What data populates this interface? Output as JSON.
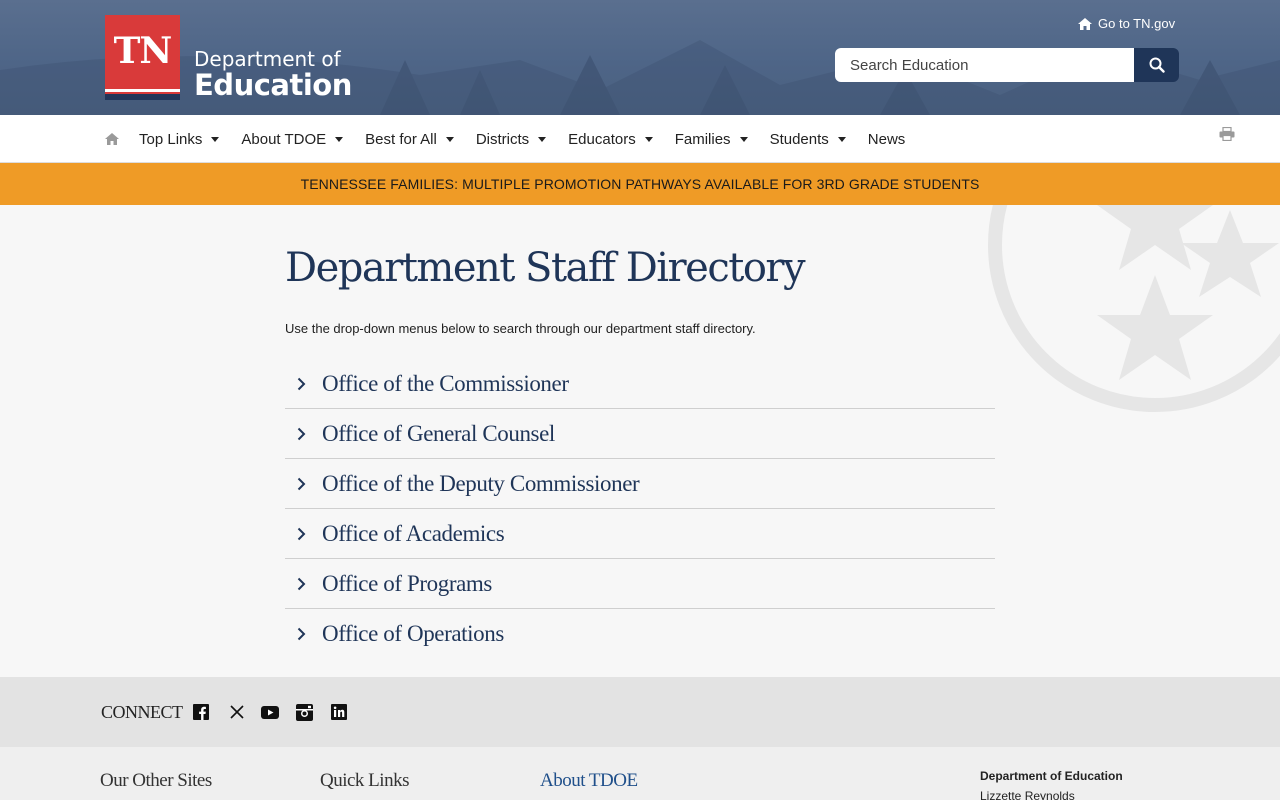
{
  "header": {
    "logo_mark": "TN",
    "logo_line1": "Department of",
    "logo_line2": "Education",
    "goto_link": "Go to TN.gov",
    "search_placeholder": "Search Education"
  },
  "nav": {
    "items": [
      {
        "label": "Top Links",
        "dropdown": true
      },
      {
        "label": "About TDOE",
        "dropdown": true
      },
      {
        "label": "Best for All",
        "dropdown": true
      },
      {
        "label": "Districts",
        "dropdown": true
      },
      {
        "label": "Educators",
        "dropdown": true
      },
      {
        "label": "Families",
        "dropdown": true
      },
      {
        "label": "Students",
        "dropdown": true
      },
      {
        "label": "News",
        "dropdown": false
      }
    ]
  },
  "alert": {
    "text": "TENNESSEE FAMILIES: MULTIPLE PROMOTION PATHWAYS AVAILABLE FOR 3RD GRADE STUDENTS",
    "color": "#ef9b26"
  },
  "main": {
    "title": "Department Staff Directory",
    "intro": "Use the drop-down menus below to search through our department staff directory.",
    "offices": [
      "Office of the Commissioner",
      "Office of General Counsel",
      "Office of the Deputy Commissioner",
      "Office of Academics",
      "Office of Programs",
      "Office of Operations"
    ]
  },
  "connect": {
    "label": "CONNECT",
    "icons": [
      "facebook-icon",
      "x-icon",
      "youtube-icon",
      "instagram-icon",
      "linkedin-icon"
    ]
  },
  "footer": {
    "col1": "Our Other Sites",
    "col2": "Quick Links",
    "col3": "About TDOE",
    "dept": "Department of Education",
    "name": "Lizzette Reynolds"
  },
  "colors": {
    "brand_navy": "#1f3558",
    "brand_red": "#d93a3a",
    "header_bg": "#4e6587"
  }
}
